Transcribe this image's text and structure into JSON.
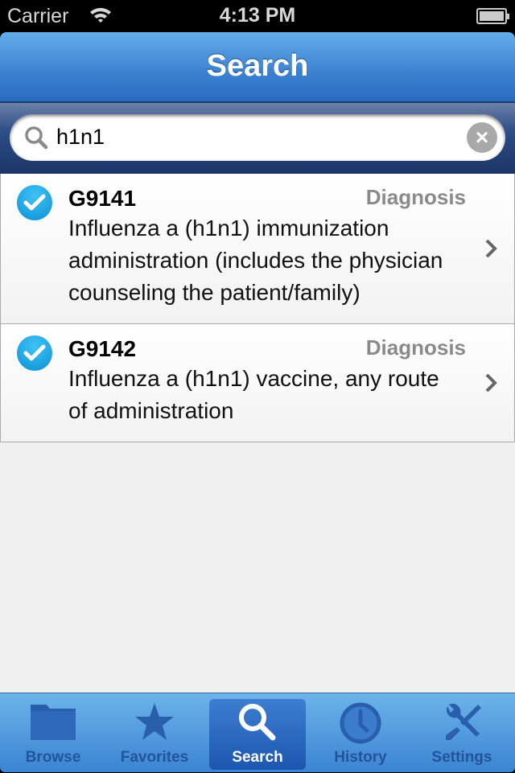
{
  "status_bar": {
    "carrier": "Carrier",
    "time": "4:13 PM"
  },
  "nav": {
    "title": "Search"
  },
  "search": {
    "value": "h1n1",
    "clear_icon": "clear-icon"
  },
  "results": [
    {
      "code": "G9141",
      "type": "Diagnosis",
      "description": "Influenza a (h1n1) immunization administration (includes the physician counseling the patient/family)"
    },
    {
      "code": "G9142",
      "type": "Diagnosis",
      "description": "Influenza a (h1n1) vaccine, any route of administration"
    }
  ],
  "tabs": [
    {
      "label": "Browse",
      "icon": "folder-icon"
    },
    {
      "label": "Favorites",
      "icon": "star-icon"
    },
    {
      "label": "Search",
      "icon": "search-icon",
      "active": true
    },
    {
      "label": "History",
      "icon": "clock-icon"
    },
    {
      "label": "Settings",
      "icon": "tools-icon"
    }
  ],
  "colors": {
    "accent": "#3b80cf",
    "check": "#0d8fd6",
    "tab_label": "#23539a"
  }
}
